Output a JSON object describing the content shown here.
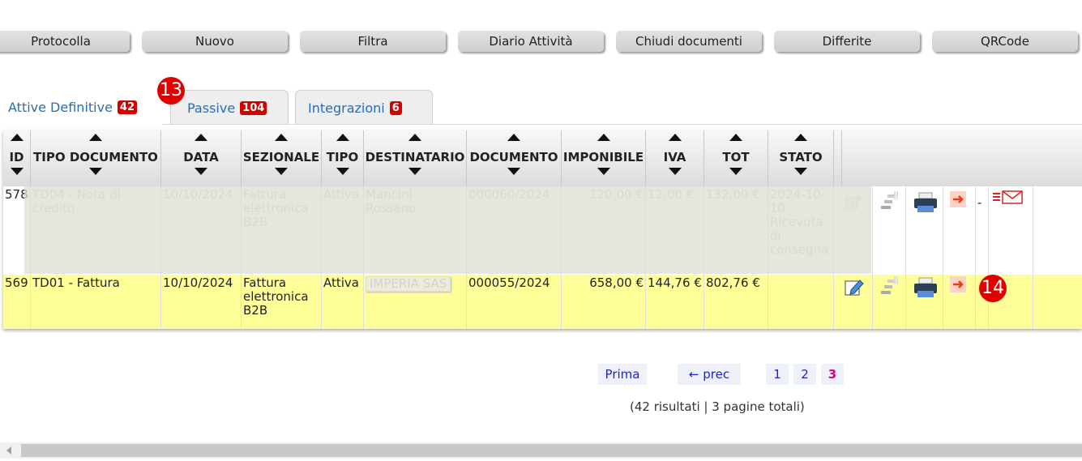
{
  "toolbar": {
    "buttons": [
      "Protocolla",
      "Nuovo",
      "Filtra",
      "Diario Attività",
      "Chiudi documenti",
      "Differite",
      "QRCode"
    ]
  },
  "tabs": [
    {
      "label": "Attive Definitive",
      "count": "42"
    },
    {
      "label": "Passive",
      "count": "104"
    },
    {
      "label": "Integrazioni",
      "count": "6"
    }
  ],
  "callouts": {
    "tabs": "13",
    "actions": "14"
  },
  "table": {
    "headers": [
      "ID",
      "TIPO DOCUMENTO",
      "DATA",
      "SEZIONALE",
      "TIPO",
      "DESTINATARIO",
      "DOCUMENTO",
      "IMPONIBILE",
      "IVA",
      "TOT",
      "STATO"
    ],
    "rows": [
      {
        "id": "578",
        "tipo_documento": "TD04 - Nota di credito",
        "data": "10/10/2024",
        "sezionale": "Fattura elettronica B2B",
        "tipo": "Attiva",
        "destinatario": "Mancini Rossano",
        "documento": "000060/2024",
        "imponibile": "120,00 €",
        "iva": "12,00 €",
        "tot": "132,00 €",
        "stato": "2024-10-10 Ricevuta di consegna",
        "extra": "-"
      },
      {
        "id": "569",
        "tipo_documento": "TD01 - Fattura",
        "data": "10/10/2024",
        "sezionale": "Fattura elettronica B2B",
        "tipo": "Attiva",
        "destinatario": "IMPERIA SAS",
        "documento": "000055/2024",
        "imponibile": "658,00 €",
        "iva": "144,76 €",
        "tot": "802,76 €",
        "stato": ""
      }
    ]
  },
  "pager": {
    "first": "Prima",
    "prev": "← prec",
    "pages": [
      "1",
      "2",
      "3"
    ],
    "current": "3",
    "summary": "(42 risultati | 3 pagine totali)"
  },
  "colors": {
    "tab_text": "#2a6db2",
    "badge": "#d40000",
    "highlight_row": "#ffff99",
    "pager_link": "#2222cc",
    "pager_current": "#e0007a"
  }
}
